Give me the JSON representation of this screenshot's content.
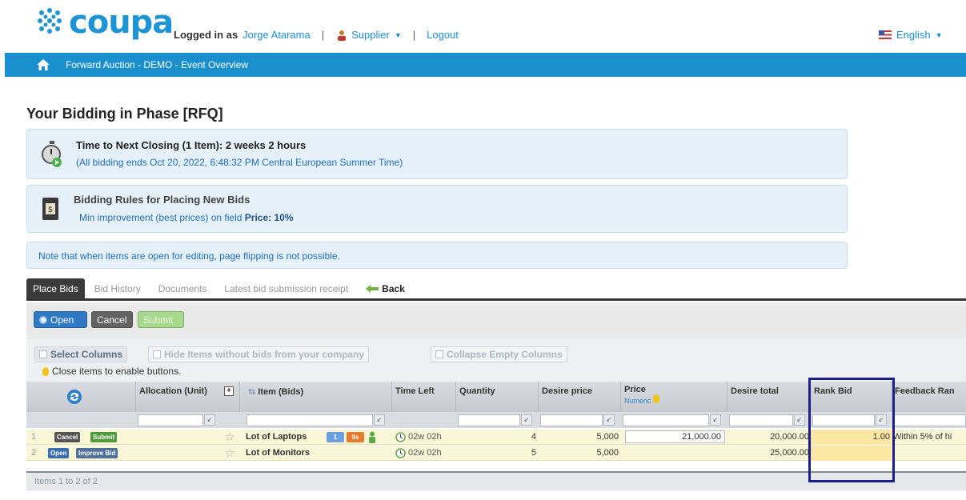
{
  "header": {
    "logo_text": "coupa",
    "logged_in_prefix": "Logged in as",
    "user_name": "Jorge Atarama",
    "role_menu": "Supplier",
    "logout_label": "Logout",
    "language": "English"
  },
  "navbar": {
    "title": "Forward Auction - DEMO - Event Overview"
  },
  "page": {
    "title": "Your Bidding in Phase [RFQ]",
    "closing": {
      "title": "Time to Next Closing (1 Item):  2 weeks 2 hours",
      "subtitle": "(All bidding ends Oct 20, 2022, 6:48:32 PM Central European Summer Time)"
    },
    "rules": {
      "title": "Bidding Rules for Placing New Bids",
      "text_prefix": "Min improvement (best prices) on field",
      "field": "Price",
      "value": ": 10%"
    },
    "note": "Note that when items are open for editing, page flipping is not possible."
  },
  "tabs": [
    {
      "label": "Place Bids"
    },
    {
      "label": "Bid History"
    },
    {
      "label": "Documents"
    },
    {
      "label": "Latest bid submission receipt"
    },
    {
      "label": "Back"
    }
  ],
  "actions": {
    "open": "Open",
    "cancel": "Cancel",
    "submit": "Submit"
  },
  "column_options": {
    "select_columns": "Select Columns",
    "hide_items": "Hide Items without bids from your company",
    "collapse_empty": "Collapse Empty Columns",
    "hint": "Close items to enable buttons."
  },
  "grid": {
    "headers": {
      "allocation": "Allocation (Unit)",
      "item": "Item (Bids)",
      "time_left": "Time Left",
      "quantity": "Quantity",
      "desire_price": "Desire price",
      "price": "Price",
      "price_sub": "Numeric",
      "desire_total": "Desire total",
      "rank_bid": "Rank Bid",
      "feedback": "Feedback Ran"
    },
    "rows": [
      {
        "num": "1",
        "btn_a": "Cancel",
        "btn_b": "Submit",
        "item": "Lot of Laptops",
        "badge_a": "1",
        "badge_b": "9s",
        "time_left": "02w 02h",
        "quantity": "4",
        "desire_price": "5,000",
        "price": "21,000.00",
        "desire_total": "20,000.00",
        "rank_bid": "1.00",
        "feedback": "Within 5% of hi"
      },
      {
        "num": "2",
        "btn_a": "Open",
        "btn_b": "Improve Bid",
        "item": "Lot of Monitors",
        "time_left": "02w 02h",
        "quantity": "5",
        "desire_price": "5,000",
        "price": "",
        "desire_total": "25,000.00",
        "rank_bid": "",
        "feedback": ""
      }
    ],
    "footer": "Items  1  to 2 of 2"
  },
  "colors": {
    "brand": "#1d94d6",
    "navbar": "#1a8fcd",
    "row_bg": "#f9f5d7",
    "highlight": "#1c1f8a"
  }
}
